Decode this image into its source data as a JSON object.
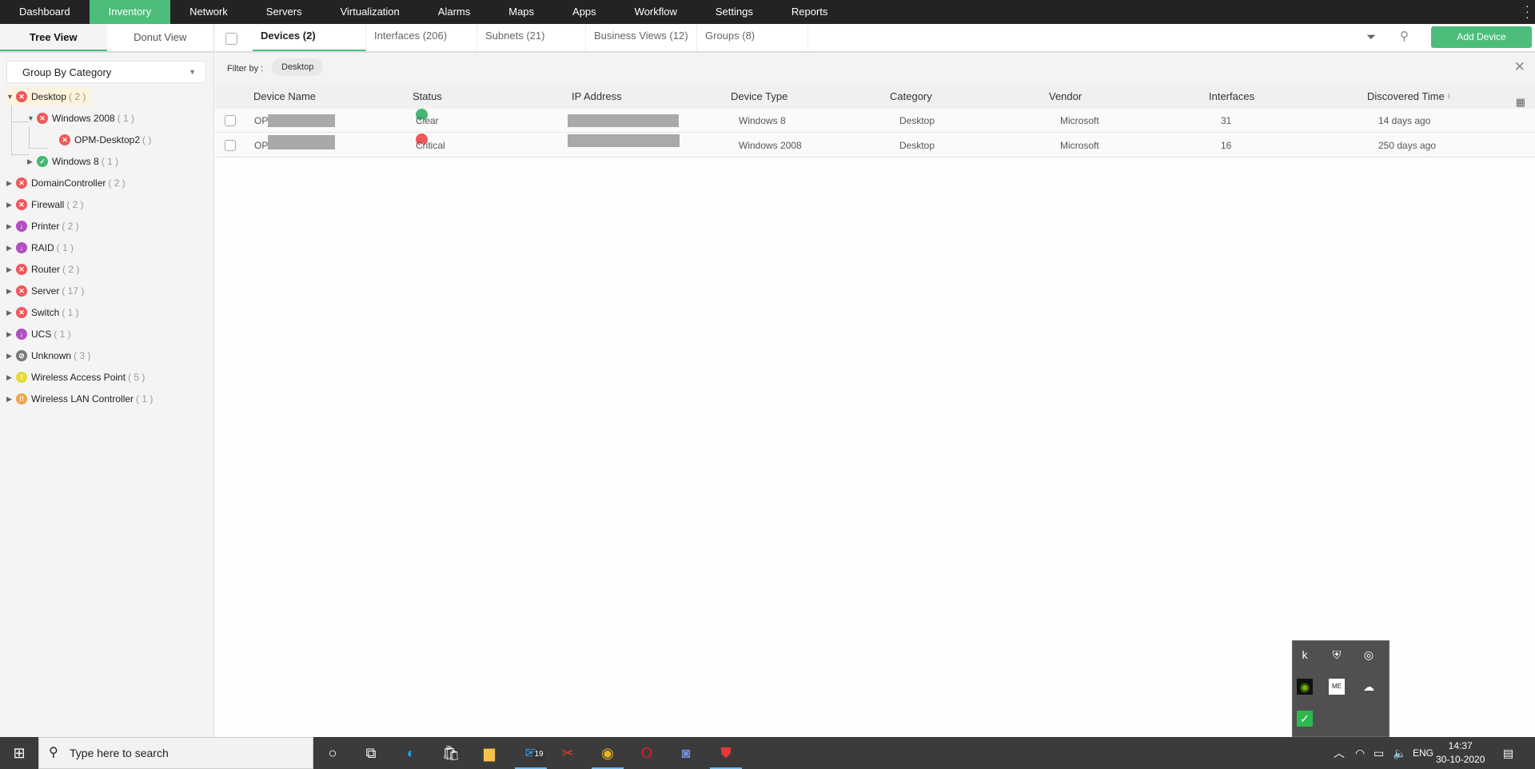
{
  "nav": [
    "Dashboard",
    "Inventory",
    "Network",
    "Servers",
    "Virtualization",
    "Alarms",
    "Maps",
    "Apps",
    "Workflow",
    "Settings",
    "Reports"
  ],
  "view_tabs": {
    "tree": "Tree View",
    "donut": "Donut View"
  },
  "group_by": "Group By Category",
  "tree": [
    {
      "label": "Desktop",
      "count": "( 2 )",
      "status": "critical"
    },
    {
      "label": "Windows 2008",
      "count": "( 1 )",
      "status": "critical"
    },
    {
      "label": "OPM-Desktop2",
      "count": "( )",
      "status": "critical"
    },
    {
      "label": "Windows 8",
      "count": "( 1 )",
      "status": "clear"
    },
    {
      "label": "DomainController",
      "count": "( 2 )",
      "status": "critical"
    },
    {
      "label": "Firewall",
      "count": "( 2 )",
      "status": "critical"
    },
    {
      "label": "Printer",
      "count": "( 2 )",
      "status": "down"
    },
    {
      "label": "RAID",
      "count": "( 1 )",
      "status": "down"
    },
    {
      "label": "Router",
      "count": "( 2 )",
      "status": "critical"
    },
    {
      "label": "Server",
      "count": "( 17 )",
      "status": "critical"
    },
    {
      "label": "Switch",
      "count": "( 1 )",
      "status": "critical"
    },
    {
      "label": "UCS",
      "count": "( 1 )",
      "status": "down"
    },
    {
      "label": "Unknown",
      "count": "( 3 )",
      "status": "unknown"
    },
    {
      "label": "Wireless Access Point",
      "count": "( 5 )",
      "status": "warning"
    },
    {
      "label": "Wireless LAN Controller",
      "count": "( 1 )",
      "status": "trouble"
    }
  ],
  "tabs": [
    "Devices (2)",
    "Interfaces (206)",
    "Subnets (21)",
    "Business Views (12)",
    "Groups (8)"
  ],
  "add_device": "Add Device",
  "filter": {
    "label": "Filter by :",
    "chip": "Desktop"
  },
  "columns": [
    "Device Name",
    "Status",
    "IP Address",
    "Device Type",
    "Category",
    "Vendor",
    "Interfaces",
    "Discovered Time"
  ],
  "rows": [
    {
      "name": "OP",
      "status": "Clear",
      "type": "Windows 8",
      "category": "Desktop",
      "vendor": "Microsoft",
      "interfaces": "31",
      "discovered": "14 days ago"
    },
    {
      "name": "OP",
      "status": "Critical",
      "type": "Windows 2008",
      "category": "Desktop",
      "vendor": "Microsoft",
      "interfaces": "16",
      "discovered": "250 days ago"
    }
  ],
  "taskbar": {
    "search_placeholder": "Type here to search",
    "mail_badge": "19",
    "lang": "ENG",
    "time": "14:37",
    "date": "30-10-2020"
  },
  "colors": {
    "accent": "#4dbd7b",
    "critical": "#f0575b",
    "clear": "#44b876",
    "down": "#b24fc2"
  }
}
